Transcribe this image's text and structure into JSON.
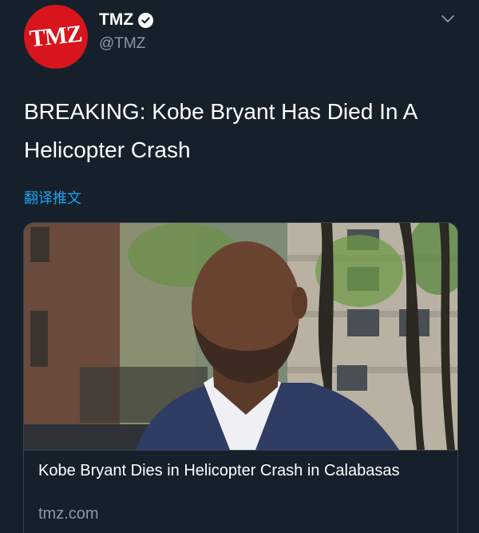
{
  "tweet": {
    "avatar_text": "TMZ",
    "display_name": "TMZ",
    "handle": "@TMZ",
    "text": "BREAKING: Kobe Bryant Has Died In A Helicopter Crash",
    "translate_label": "翻译推文"
  },
  "card": {
    "title": "Kobe Bryant Dies in Helicopter Crash in Calabasas",
    "domain": "tmz.com"
  },
  "icons": {
    "verified": "verified-badge-icon",
    "more": "chevron-down-icon"
  },
  "colors": {
    "background": "#15202b",
    "brand_red": "#d8141c",
    "link_blue": "#1da1f2",
    "secondary_text": "#8b98a5",
    "border": "#38444d"
  }
}
